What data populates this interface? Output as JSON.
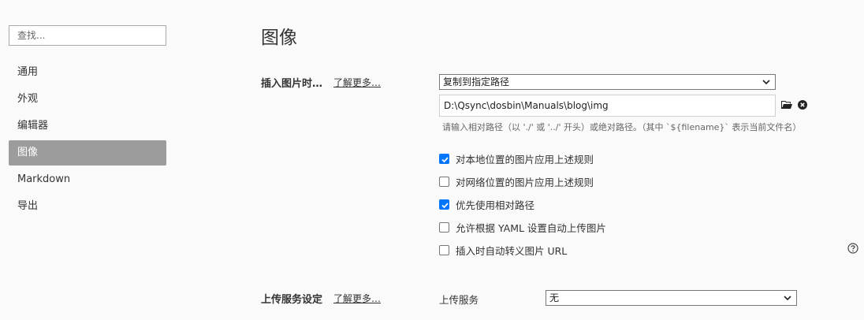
{
  "sidebar": {
    "search_placeholder": "查找...",
    "items": [
      {
        "label": "通用",
        "active": false
      },
      {
        "label": "外观",
        "active": false
      },
      {
        "label": "编辑器",
        "active": false
      },
      {
        "label": "图像",
        "active": true
      },
      {
        "label": "Markdown",
        "active": false
      },
      {
        "label": "导出",
        "active": false
      }
    ]
  },
  "main": {
    "title": "图像",
    "insert_section": {
      "label": "插入图片时…",
      "learn_more": "了解更多…",
      "action_select": "复制到指定路径",
      "path_value": "D:\\Qsync\\dosbin\\Manuals\\blog\\img",
      "path_hint": "请输入相对路径（以 './' 或 '../' 开头）或绝对路径。（其中 `${filename}` 表示当前文件名）",
      "options": [
        {
          "label": "对本地位置的图片应用上述规则",
          "checked": true
        },
        {
          "label": "对网络位置的图片应用上述规则",
          "checked": false
        },
        {
          "label": "优先使用相对路径",
          "checked": true
        },
        {
          "label": "允许根据 YAML 设置自动上传图片",
          "checked": false
        },
        {
          "label": "插入时自动转义图片 URL",
          "checked": false
        }
      ]
    },
    "upload_section": {
      "label": "上传服务设定",
      "learn_more": "了解更多…",
      "service_label": "上传服务",
      "service_select": "无"
    }
  },
  "colors": {
    "accent": "#0075ff",
    "active_nav_bg": "#9c9c9c",
    "background": "#fafafa"
  },
  "icons": [
    "folder-icon",
    "clear-icon",
    "help-icon",
    "chevron-down-icon",
    "checkmark-icon"
  ]
}
